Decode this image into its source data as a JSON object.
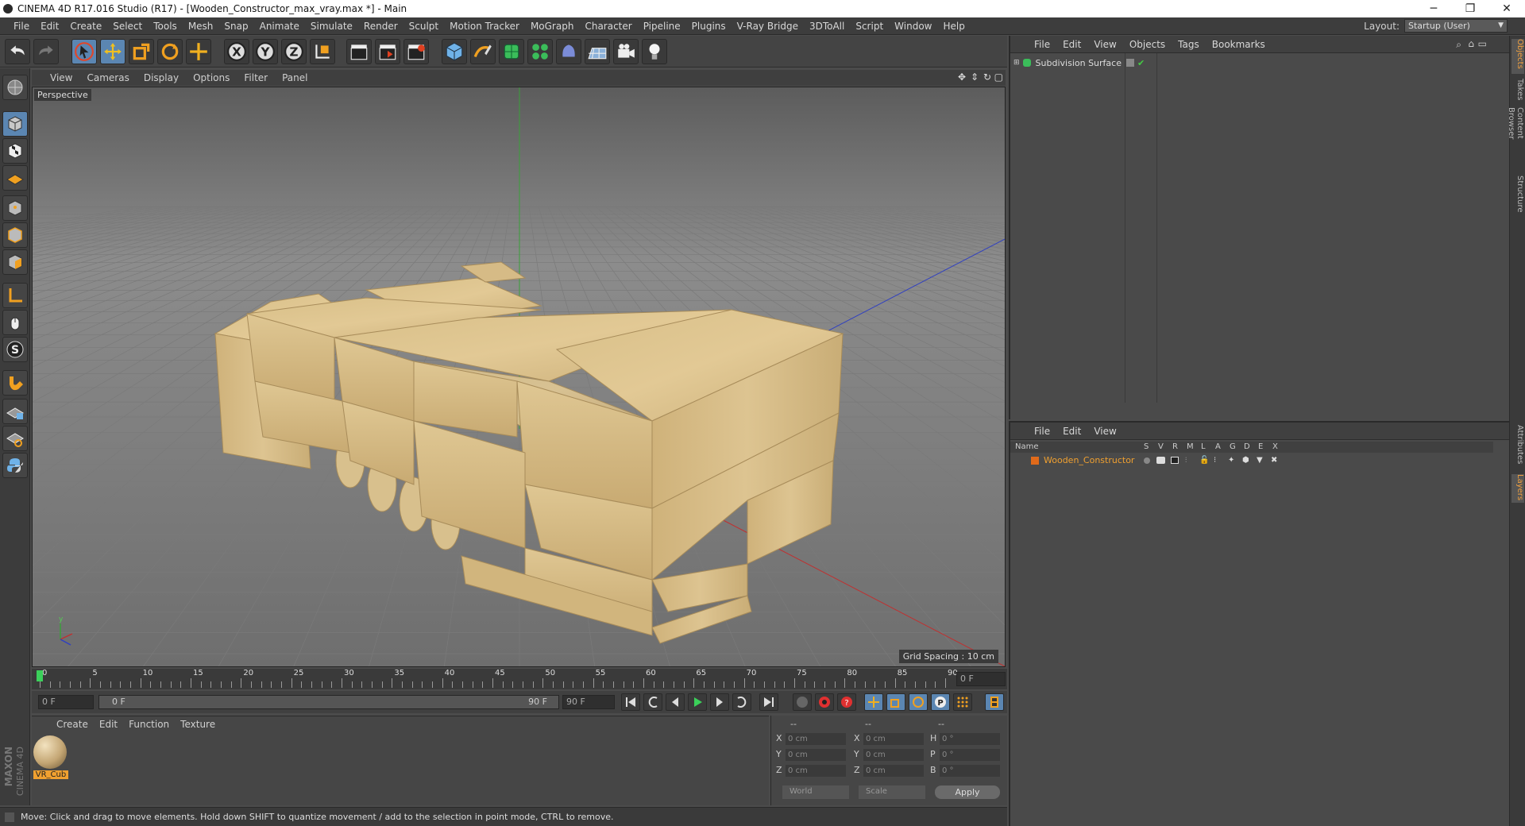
{
  "titlebar": {
    "title": "CINEMA 4D R17.016 Studio (R17) - [Wooden_Constructor_max_vray.max *] - Main",
    "minimize": "─",
    "maximize": "❐",
    "close": "✕"
  },
  "menubar": {
    "items": [
      "File",
      "Edit",
      "Create",
      "Select",
      "Tools",
      "Mesh",
      "Snap",
      "Animate",
      "Simulate",
      "Render",
      "Sculpt",
      "Motion Tracker",
      "MoGraph",
      "Character",
      "Pipeline",
      "Plugins",
      "V-Ray Bridge",
      "3DToAll",
      "Script",
      "Window",
      "Help"
    ]
  },
  "layout": {
    "label": "Layout:",
    "value": "Startup (User)"
  },
  "viewport": {
    "menu": [
      "View",
      "Cameras",
      "Display",
      "Options",
      "Filter",
      "Panel"
    ],
    "label": "Perspective",
    "grid_spacing": "Grid Spacing : 10 cm"
  },
  "timeline": {
    "ticks": [
      "0",
      "5",
      "10",
      "15",
      "20",
      "25",
      "30",
      "35",
      "40",
      "45",
      "50",
      "55",
      "60",
      "65",
      "70",
      "75",
      "80",
      "85",
      "90"
    ],
    "current_frame": "0 F",
    "start_frame": "0 F",
    "range_start": "0 F",
    "range_end": "90 F",
    "end_frame": "90 F"
  },
  "materials": {
    "menu": [
      "Create",
      "Edit",
      "Function",
      "Texture"
    ],
    "items": [
      {
        "name": "VR_Cub"
      }
    ]
  },
  "coords": {
    "headers": [
      "--",
      "--",
      "--"
    ],
    "rows": [
      {
        "a": "X",
        "av": "0 cm",
        "b": "X",
        "bv": "0 cm",
        "c": "H",
        "cv": "0 °"
      },
      {
        "a": "Y",
        "av": "0 cm",
        "b": "Y",
        "bv": "0 cm",
        "c": "P",
        "cv": "0 °"
      },
      {
        "a": "Z",
        "av": "0 cm",
        "b": "Z",
        "bv": "0 cm",
        "c": "B",
        "cv": "0 °"
      }
    ],
    "space": "World",
    "mode": "Scale",
    "apply": "Apply"
  },
  "status": {
    "text": "Move: Click and drag to move elements. Hold down SHIFT to quantize movement / add to the selection in point mode, CTRL to remove."
  },
  "objects": {
    "menu": [
      "File",
      "Edit",
      "View",
      "Objects",
      "Tags",
      "Bookmarks"
    ],
    "items": [
      {
        "name": "Subdivision Surface"
      }
    ]
  },
  "layers": {
    "menu": [
      "File",
      "Edit",
      "View"
    ],
    "name_header": "Name",
    "col_headers": [
      "S",
      "V",
      "R",
      "M",
      "L",
      "A",
      "G",
      "D",
      "E",
      "X"
    ],
    "items": [
      {
        "name": "Wooden_Constructor",
        "color": "#e06a1a"
      }
    ]
  },
  "sidetabs": [
    "Objects",
    "Takes",
    "Content Browser",
    "Structure",
    "Attributes",
    "Layers"
  ],
  "brand": {
    "maxon": "MAXON",
    "c4d": "CINEMA 4D"
  },
  "colors": {
    "accent": "#5b86b2",
    "wood": "#d9c08a",
    "highlight": "#f0a030"
  }
}
